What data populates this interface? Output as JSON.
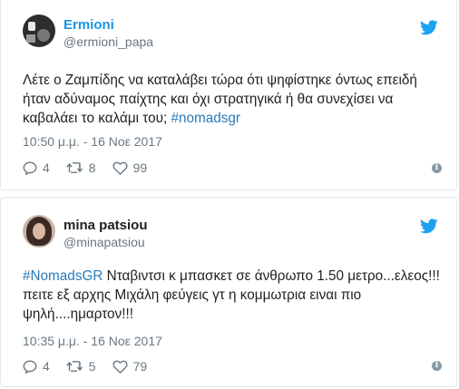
{
  "tweets": [
    {
      "name": "Ermioni",
      "handle": "@ermioni_papa",
      "text_prefix": "Λέτε ο Ζαμπίδης να καταλάβει τώρα ότι ψηφίστηκε όντως επειδή ήταν αδύναμος παίχτης και όχι στρατηγικά ή θα συνεχίσει να καβαλάει το καλάμι του; ",
      "text_hashtag": "#nomadsgr",
      "timestamp": "10:50 μ.μ. - 16 Νοε 2017",
      "replies": "4",
      "retweets": "8",
      "likes": "99"
    },
    {
      "name": "mina patsiou",
      "handle": "@minapatsiou",
      "text_hashtag": "#NomadsGR",
      "text_suffix": " Νταβιντσι κ μπασκετ σε άνθρωπο 1.50 μετρο...ελεος!!!πειτε εξ αρχης Μιχάλη φεύγεις γτ η κομμωτρια ειναι πιο ψηλή....ημαρτον!!!",
      "timestamp": "10:35 μ.μ. - 16 Νοε 2017",
      "replies": "4",
      "retweets": "5",
      "likes": "79"
    }
  ],
  "colors": {
    "link": "#2b7bb9",
    "name_link": "#1b95e0",
    "muted": "#697882",
    "twitter_blue": "#1da1f2"
  },
  "icons": [
    "twitter-bird-icon",
    "reply-icon",
    "retweet-icon",
    "heart-icon",
    "info-icon"
  ]
}
